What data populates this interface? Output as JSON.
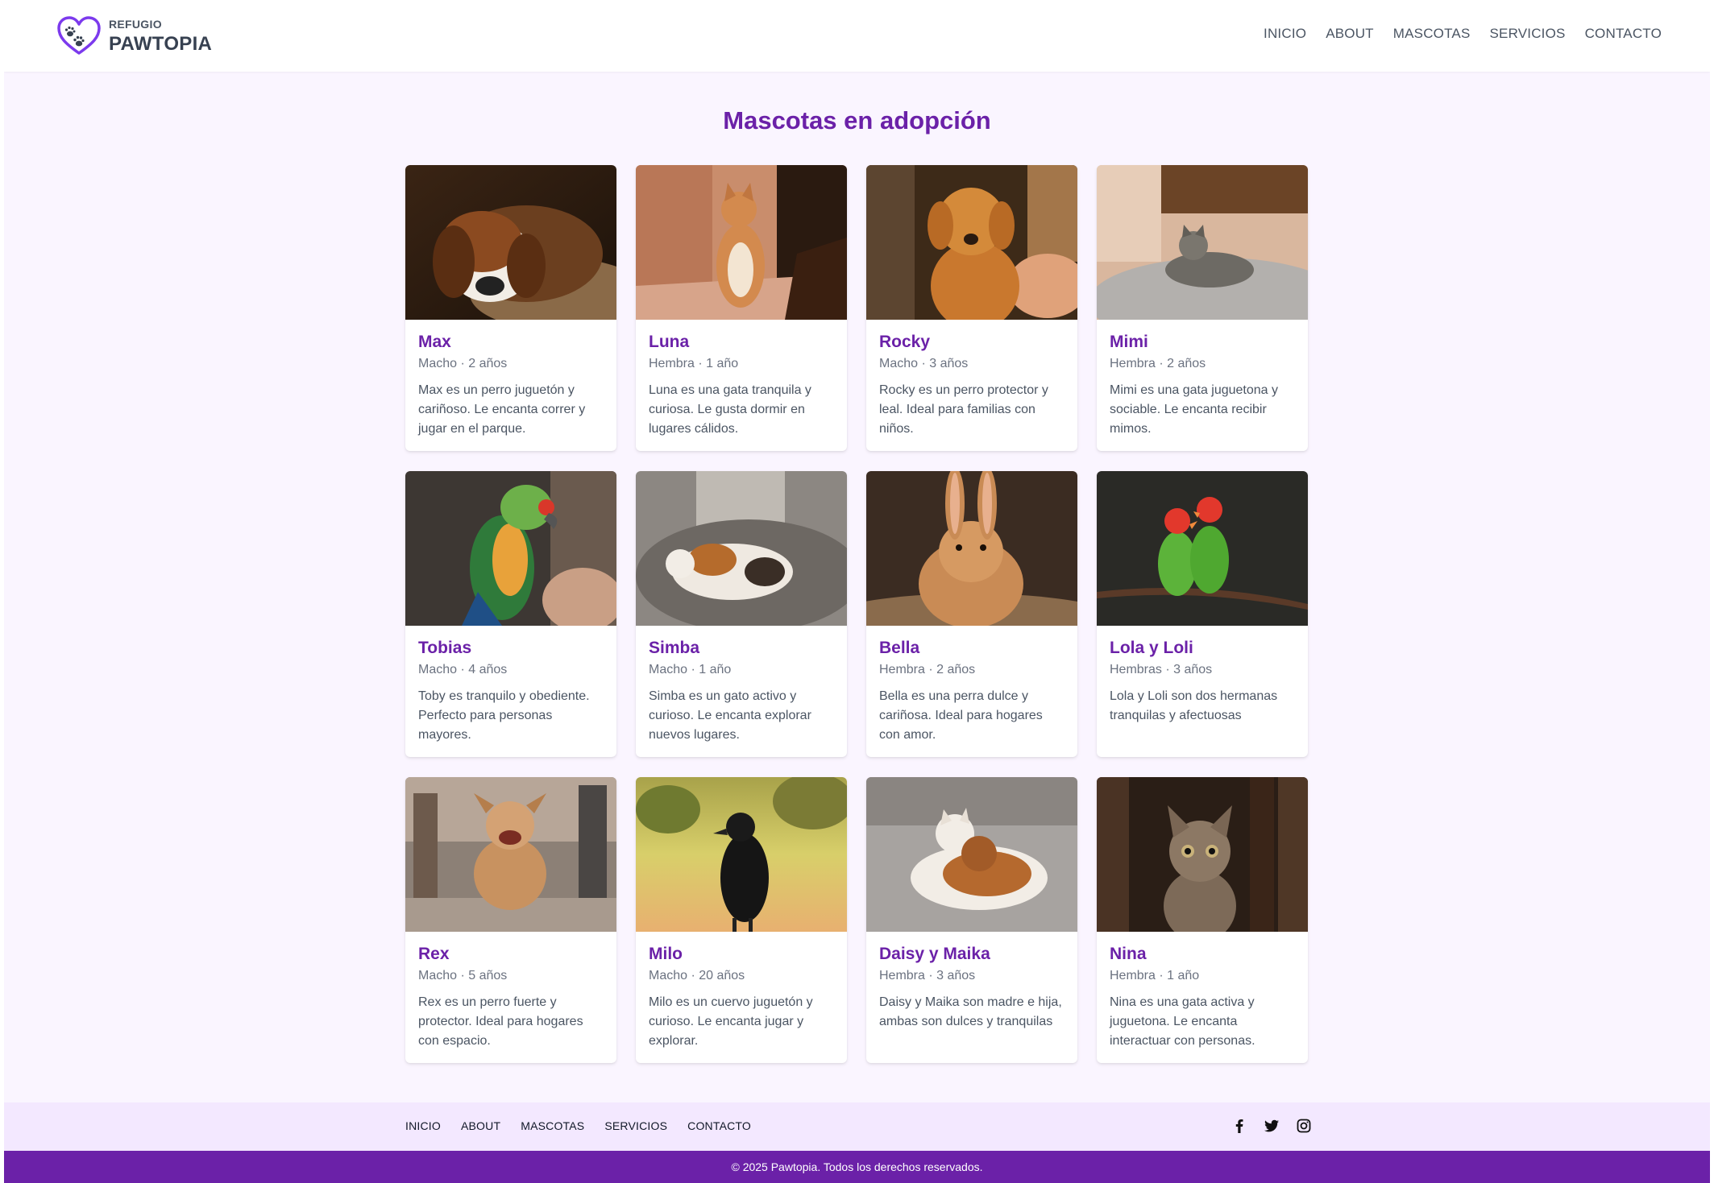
{
  "header": {
    "logo_small": "REFUGIO",
    "logo_big": "PAWTOPIA",
    "nav": [
      "INICIO",
      "ABOUT",
      "MASCOTAS",
      "SERVICIOS",
      "CONTACTO"
    ]
  },
  "main": {
    "title": "Mascotas en adopción",
    "pets": [
      {
        "name": "Max",
        "meta": "Macho · 2 años",
        "desc": "Max es un perro juguetón y cariñoso. Le encanta correr y jugar en el parque.",
        "image": "beagle-sleeping"
      },
      {
        "name": "Luna",
        "meta": "Hembra · 1 año",
        "desc": "Luna es una gata tranquila y curiosa. Le gusta dormir en lugares cálidos.",
        "image": "orange-cat-sitting"
      },
      {
        "name": "Rocky",
        "meta": "Macho · 3 años",
        "desc": "Rocky es un perro protector y leal. Ideal para familias con niños.",
        "image": "golden-puppy"
      },
      {
        "name": "Mimi",
        "meta": "Hembra · 2 años",
        "desc": "Mimi es una gata juguetona y sociable. Le encanta recibir mimos.",
        "image": "tabby-cat-lying"
      },
      {
        "name": "Tobias",
        "meta": "Macho · 4 años",
        "desc": "Toby es tranquilo y obediente. Perfecto para personas mayores.",
        "image": "parrot"
      },
      {
        "name": "Simba",
        "meta": "Macho · 1 año",
        "desc": "Simba es un gato activo y curioso. Le encanta explorar nuevos lugares.",
        "image": "calico-cat-sleeping"
      },
      {
        "name": "Bella",
        "meta": "Hembra · 2 años",
        "desc": "Bella es una perra dulce y cariñosa. Ideal para hogares con amor.",
        "image": "rabbit"
      },
      {
        "name": "Lola y Loli",
        "meta": "Hembras · 3 años",
        "desc": "Lola y Loli son dos hermanas tranquilas y afectuosas",
        "image": "lovebirds"
      },
      {
        "name": "Rex",
        "meta": "Macho · 5 años",
        "desc": "Rex es un perro fuerte y protector. Ideal para hogares con espacio.",
        "image": "small-dog-running"
      },
      {
        "name": "Milo",
        "meta": "Macho · 20 años",
        "desc": "Milo es un cuervo juguetón y curioso. Le encanta jugar y explorar.",
        "image": "crow"
      },
      {
        "name": "Daisy y Maika",
        "meta": "Hembra · 3 años",
        "desc": "Daisy y Maika son madre e hija, ambas son dulces y tranquilas",
        "image": "two-cats-cuddling"
      },
      {
        "name": "Nina",
        "meta": "Hembra · 1 año",
        "desc": "Nina es una gata activa y juguetona. Le encanta interactuar con personas.",
        "image": "tabby-kitten"
      }
    ]
  },
  "footer": {
    "nav": [
      "INICIO",
      "ABOUT",
      "MASCOTAS",
      "SERVICIOS",
      "CONTACTO"
    ],
    "social": [
      "facebook-icon",
      "twitter-icon",
      "instagram-icon"
    ],
    "copyright": "© 2025 Pawtopia. Todos los derechos reservados."
  },
  "colors": {
    "accent": "#6b21a8",
    "page_bg": "#faf5ff",
    "footer_bg": "#f3e8ff"
  }
}
